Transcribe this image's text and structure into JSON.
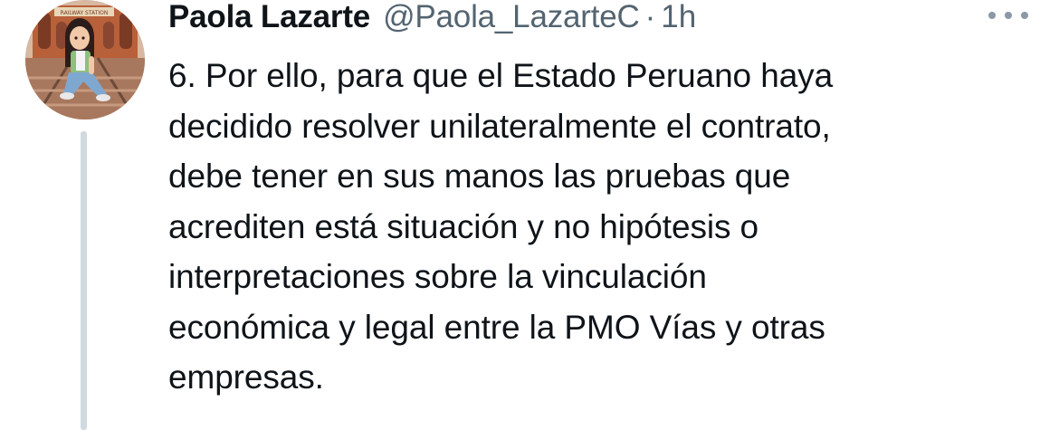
{
  "tweet": {
    "author_name": "Paola Lazarte",
    "author_handle": "@Paola_LazarteC",
    "separator": "·",
    "time": "1h",
    "body_lines": [
      "6. Por ello, para que el Estado Peruano haya",
      "decidido resolver unilateralmente el contrato,",
      "debe tener en sus manos las pruebas que",
      "acrediten está situación y no hipótesis o",
      "interpretaciones sobre la vinculación",
      "económica y legal entre la PMO Vías y otras",
      "empresas."
    ],
    "avatar_sign_text": "RAILWAY STATION"
  },
  "colors": {
    "name": "#0f1419",
    "secondary": "#536471",
    "thread_line": "#cfd9de"
  },
  "icons": {
    "more": "more-horizontal-icon"
  }
}
